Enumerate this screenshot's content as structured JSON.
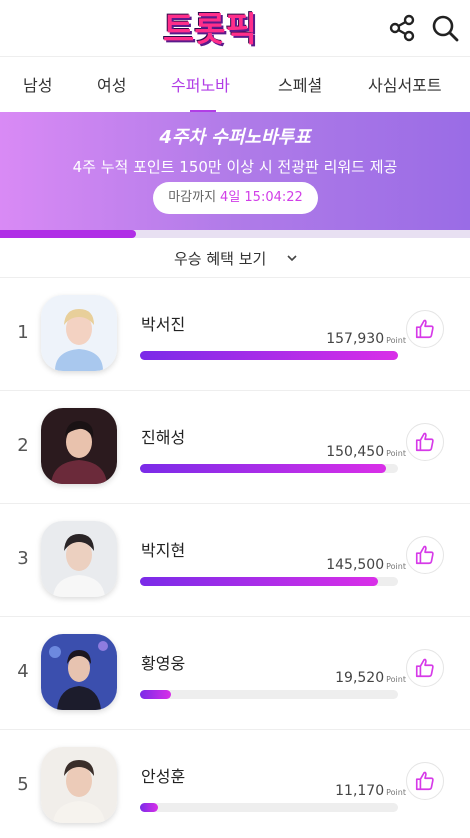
{
  "header": {
    "logo_chars": [
      "트",
      "롯",
      "픽"
    ],
    "share_icon": "share-icon",
    "search_icon": "search-icon"
  },
  "tabs": [
    {
      "label": "남성",
      "active": false
    },
    {
      "label": "여성",
      "active": false
    },
    {
      "label": "수퍼노바",
      "active": true
    },
    {
      "label": "스페셜",
      "active": false
    },
    {
      "label": "사심서포트",
      "active": false
    }
  ],
  "banner": {
    "title": "4주차 수퍼노바투표",
    "subtitle": "4주 누적 포인트 150만 이상 시 전광판 리워드 제공",
    "deadline_label": "마감까지",
    "deadline_value": "4일 15:04:22",
    "progress_fraction": 0.29
  },
  "benefit": {
    "label": "우승 혜택 보기",
    "icon": "chevron-down-icon"
  },
  "ranking": [
    {
      "rank": "1",
      "name": "박서진",
      "score": "157,930",
      "unit": "Point",
      "fraction": 1.0
    },
    {
      "rank": "2",
      "name": "진해성",
      "score": "150,450",
      "unit": "Point",
      "fraction": 0.953
    },
    {
      "rank": "3",
      "name": "박지현",
      "score": "145,500",
      "unit": "Point",
      "fraction": 0.921
    },
    {
      "rank": "4",
      "name": "황영웅",
      "score": "19,520",
      "unit": "Point",
      "fraction": 0.12
    },
    {
      "rank": "5",
      "name": "안성훈",
      "score": "11,170",
      "unit": "Point",
      "fraction": 0.07
    }
  ],
  "colors": {
    "accent": "#b13ee6",
    "bar_start": "#7a2be8",
    "bar_end": "#d92fe8",
    "like_icon": "#d63ae8"
  }
}
